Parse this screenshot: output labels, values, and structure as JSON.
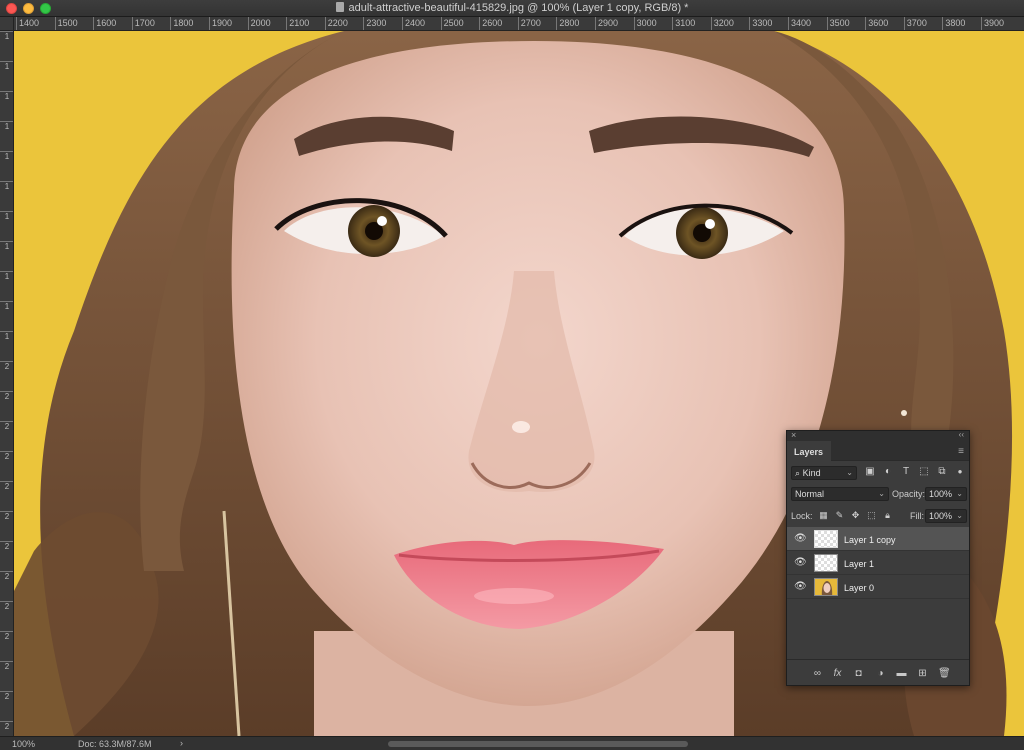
{
  "window": {
    "title": "adult-attractive-beautiful-415829.jpg @ 100% (Layer 1 copy, RGB/8) *"
  },
  "ruler": {
    "h_labels": [
      "1400",
      "1500",
      "1600",
      "1700",
      "1800",
      "1900",
      "2000",
      "2100",
      "2200",
      "2300",
      "2400",
      "2500",
      "2600",
      "2700",
      "2800",
      "2900",
      "3000",
      "3100",
      "3200",
      "3300",
      "3400",
      "3500",
      "3600",
      "3700",
      "3800",
      "3900"
    ],
    "v_labels": [
      "1",
      "1",
      "1",
      "1",
      "1",
      "1",
      "1",
      "1",
      "1",
      "1",
      "1",
      "2",
      "2",
      "2",
      "2",
      "2",
      "2",
      "2",
      "2",
      "2",
      "2",
      "2",
      "2",
      "2"
    ]
  },
  "status": {
    "zoom": "100%",
    "doc": "Doc: 63.3M/87.6M",
    "arrow": "›"
  },
  "layers_panel": {
    "tab_label": "Layers",
    "filter_label": "Kind",
    "blend_mode": "Normal",
    "opacity_label": "Opacity:",
    "opacity_value": "100%",
    "lock_label": "Lock:",
    "fill_label": "Fill:",
    "fill_value": "100%",
    "layers": [
      {
        "name": "Layer 1 copy",
        "selected": true,
        "thumb": "transparent"
      },
      {
        "name": "Layer 1",
        "selected": false,
        "thumb": "transparent"
      },
      {
        "name": "Layer 0",
        "selected": false,
        "thumb": "photo"
      }
    ]
  },
  "colors": {
    "background_yellow": "#e9c23a",
    "panel_bg": "#3c3c3c",
    "selected_row": "#545454",
    "lips": "#f07a86"
  }
}
